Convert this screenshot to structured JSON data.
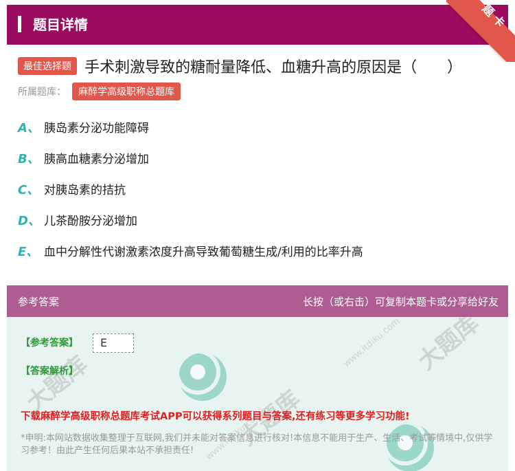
{
  "header": {
    "title": "题目详情",
    "ribbon": "题卡"
  },
  "question": {
    "type_badge": "最佳选择题",
    "text": "手术刺激导致的糖耐量降低、血糖升高的原因是（　　）"
  },
  "bank": {
    "label": "所属题库：",
    "name": "麻醉学高级职称总题库"
  },
  "options": [
    {
      "letter": "A、",
      "text": "胰岛素分泌功能障碍"
    },
    {
      "letter": "B、",
      "text": "胰高血糖素分泌增加"
    },
    {
      "letter": "C、",
      "text": "对胰岛素的拮抗"
    },
    {
      "letter": "D、",
      "text": "儿茶酚胺分泌增加"
    },
    {
      "letter": "E、",
      "text": "血中分解性代谢激素浓度升高导致葡萄糖生成/利用的比率升高"
    }
  ],
  "answer_section": {
    "left_label": "参考答案",
    "right_label": "长按（或右击）可复制本题卡或分享给好友",
    "answer_label": "【参考答案】",
    "answer_value": "E",
    "analysis_label": "【答案解析】",
    "download_text": "下载麻醉学高级职称总题库考试APP可以获得系列题目与答案,还有练习等更多学习功能!",
    "disclaimer": "*申明:本网站数据收集整理于互联网,我们并未能对答案信息进行核对!本信息不能用于生产、生活、考试等情境中,仅供学习参考！由此产生任何后果本站不承担责任!"
  },
  "watermark": {
    "brand": "大题库",
    "url": "www.itdiku.com"
  },
  "colors": {
    "header": "#9b0c61",
    "ribbon": "#e2574c",
    "option_letter": "#2fb4b0",
    "answer_bg": "#e8f4f1",
    "answer_label": "#2e9b3b",
    "download": "#e02020"
  }
}
